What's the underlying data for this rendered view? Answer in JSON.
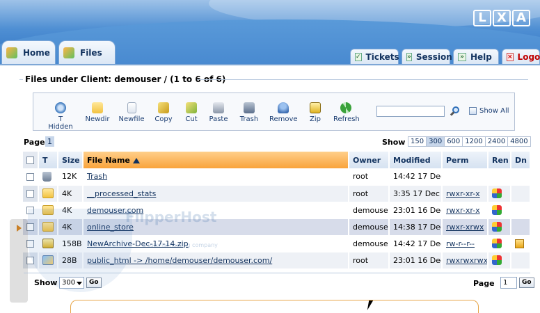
{
  "logo": [
    "L",
    "X",
    "A"
  ],
  "tabs": {
    "home": "Home",
    "files": "Files"
  },
  "right_tabs": [
    {
      "label": "Tickets",
      "icon": "ticket-icon"
    },
    {
      "label": "Session",
      "icon": "session-icon"
    },
    {
      "label": "Help",
      "icon": "help-icon"
    },
    {
      "label": "Logou",
      "icon": "logout-icon"
    }
  ],
  "section_title": "Files under Client: demouser / (1 to 6 of 6)",
  "toolbar": [
    {
      "label": "T Hidden",
      "icon": "toggle-hidden-icon",
      "color": "#2f6fb8"
    },
    {
      "label": "Newdir",
      "icon": "new-folder-icon",
      "color": "#f2c240"
    },
    {
      "label": "Newfile",
      "icon": "new-file-icon",
      "color": "#dfe6ef"
    },
    {
      "label": "Copy",
      "icon": "copy-icon",
      "color": "#d6b33a"
    },
    {
      "label": "Cut",
      "icon": "cut-icon",
      "color": "#9bc24a"
    },
    {
      "label": "Paste",
      "icon": "paste-icon",
      "color": "#8a96a8"
    },
    {
      "label": "Trash",
      "icon": "trash-icon",
      "color": "#5c6f8c"
    },
    {
      "label": "Remove",
      "icon": "remove-icon",
      "color": "#3f6fb3"
    },
    {
      "label": "Zip",
      "icon": "zip-icon",
      "color": "#e0b422"
    },
    {
      "label": "Refresh",
      "icon": "refresh-icon",
      "color": "#3aa23a"
    }
  ],
  "search": {
    "value": "",
    "show_all": "Show All"
  },
  "paging": {
    "page_label": "Page",
    "current_page": "1",
    "show_label": "Show",
    "show_options": [
      "150",
      "300",
      "600",
      "1200",
      "2400",
      "4800"
    ],
    "show_selected": "300"
  },
  "table": {
    "headers": {
      "type": "T",
      "size": "Size",
      "file_name": "File Name",
      "owner": "Owner",
      "modified": "Modified",
      "perm": "Perm",
      "ren": "Ren",
      "dn": "Dn"
    },
    "rows": [
      {
        "type": "trash",
        "size": "12K",
        "name": "Trash",
        "owner": "root",
        "modified": "14:42 17 Dec",
        "perm": "",
        "ren": false,
        "dn": false
      },
      {
        "type": "folder",
        "size": "4K",
        "name": "__processed_stats",
        "owner": "root",
        "modified": "3:35 17 Dec",
        "perm": "rwxr-xr-x",
        "ren": true,
        "dn": false
      },
      {
        "type": "folder",
        "size": "4K",
        "name": "demouser.com",
        "owner": "demouser",
        "modified": "23:01 16 Dec",
        "perm": "rwxr-xr-x",
        "ren": true,
        "dn": false
      },
      {
        "type": "folder",
        "size": "4K",
        "name": "online_store",
        "owner": "demouser",
        "modified": "14:38 17 Dec",
        "perm": "rwxr-xrwx",
        "ren": true,
        "dn": false
      },
      {
        "type": "zip",
        "size": "158B",
        "name": "NewArchive-Dec-17-14.zip",
        "owner": "demouser",
        "modified": "14:42 17 Dec",
        "perm": "rw-r--r--",
        "ren": true,
        "dn": true
      },
      {
        "type": "link",
        "size": "28B",
        "name": "public_html -> /home/demouser/demouser.com/",
        "owner": "root",
        "modified": "23:01 16 Dec",
        "perm": "rwxrwxrwx",
        "ren": true,
        "dn": false
      }
    ]
  },
  "bottom": {
    "show_label": "Show",
    "show_value": "300",
    "go": "Go",
    "page_label": "Page",
    "page_value": "1"
  },
  "watermark": {
    "title": "FlipperHost",
    "subtitle": "a tutorial hosting company"
  },
  "colors": {
    "header": "#3a7cc9",
    "accent": "#f9a33b",
    "link": "#12325e"
  }
}
